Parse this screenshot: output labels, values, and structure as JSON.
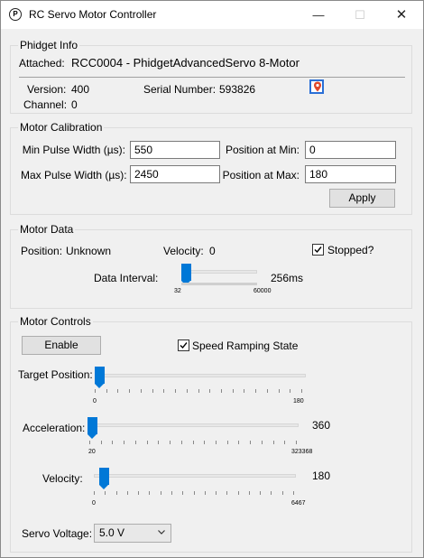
{
  "window": {
    "title": "RC Servo Motor Controller",
    "minimize": "—",
    "maximize": "☐",
    "close": "✕"
  },
  "phidget_info": {
    "title": "Phidget Info",
    "attached_label": "Attached:",
    "attached_value": "RCC0004 - PhidgetAdvancedServo 8-Motor",
    "version_label": "Version:",
    "version_value": "400",
    "serial_label": "Serial Number:",
    "serial_value": "593826",
    "channel_label": "Channel:",
    "channel_value": "0",
    "locate_icon": "map-pin-icon"
  },
  "motor_calibration": {
    "title": "Motor Calibration",
    "min_pulse_label": "Min Pulse Width (µs):",
    "min_pulse_value": "550",
    "max_pulse_label": "Max Pulse Width (µs):",
    "max_pulse_value": "2450",
    "pos_min_label": "Position at Min:",
    "pos_min_value": "0",
    "pos_max_label": "Position at Max:",
    "pos_max_value": "180",
    "apply_label": "Apply"
  },
  "motor_data": {
    "title": "Motor Data",
    "position_label": "Position:",
    "position_value": "Unknown",
    "velocity_label": "Velocity:",
    "velocity_value": "0",
    "stopped_label": "Stopped?",
    "stopped_checked": true,
    "data_interval_label": "Data Interval:",
    "data_interval_value": "256ms",
    "data_interval_min": "32",
    "data_interval_max": "60000",
    "data_interval_fraction": 0.0038
  },
  "motor_controls": {
    "title": "Motor Controls",
    "enable_label": "Enable",
    "speed_ramping_label": "Speed Ramping State",
    "speed_ramping_checked": true,
    "target_position": {
      "label": "Target Position:",
      "min": "0",
      "max": "180",
      "value": "",
      "fraction": 0.0
    },
    "acceleration": {
      "label": "Acceleration:",
      "min": "20",
      "max": "323368",
      "value": "360",
      "fraction": 0.001
    },
    "velocity": {
      "label": "Velocity:",
      "min": "0",
      "max": "6467",
      "value": "180",
      "fraction": 0.028
    },
    "servo_voltage_label": "Servo Voltage:",
    "servo_voltage_value": "5.0 V"
  }
}
